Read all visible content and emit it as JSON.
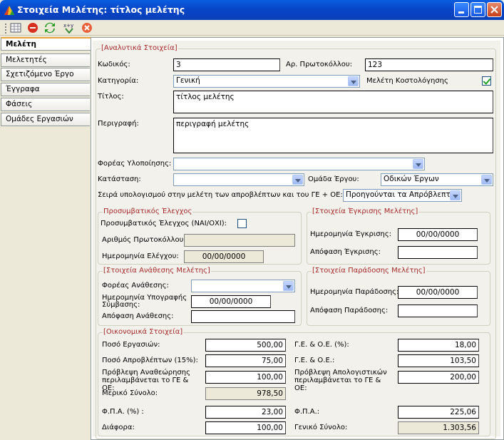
{
  "window": {
    "title": "Στοιχεία Μελέτης: τίτλος μελέτης"
  },
  "tabs": [
    "Μελέτη",
    "Μελετητές",
    "Σχετιζόμενο Έργο",
    "Έγγραφα",
    "Φάσεις",
    "Ομάδες Εργασιών"
  ],
  "analytics": {
    "legend": "[Αναλυτικά Στοιχεία]",
    "code_label": "Κωδικός:",
    "code": "3",
    "protocol_label": "Αρ. Πρωτοκόλλου:",
    "protocol": "123",
    "category_label": "Κατηγορία:",
    "category": "Γενική",
    "costing_label": "Μελέτη Κοστολόγησης",
    "costing_checked": true,
    "title_label": "Τίτλος:",
    "title": "τίτλος μελέτης",
    "desc_label": "Περιγραφή:",
    "desc": "περιγραφή μελέτης",
    "agency_label": "Φορέας Υλοποίησης:",
    "agency": "",
    "status_label": "Κατάσταση:",
    "status": "",
    "group_label": "Ομάδα Έργου:",
    "group": "Οδικών Έργων",
    "order_label": "Σειρά υπολογισμού στην μελέτη των απροβλέπτων και του ΓΕ + ΟΕ:",
    "order": "Προηγούνται τα Απρόβλεπτα"
  },
  "precontract": {
    "legend": "Προσυμβατικός Έλεγχος",
    "check_label": "Προσυμβατικός Έλεγχος (ΝΑΙ/ΟΧΙ):",
    "check_checked": false,
    "protocol_label": "Αριθμός Πρωτοκόλλου:",
    "protocol": "",
    "date_label": "Ημερομηνία Ελέγχου:",
    "date": "00/00/0000"
  },
  "approval": {
    "legend": "[Στοιχεία Έγκρισης Μελέτης]",
    "date_label": "Ημερομηνία Έγκρισης:",
    "date": "00/00/0000",
    "decision_label": "Απόφαση Έγκρισης:",
    "decision": ""
  },
  "assignment": {
    "legend": "[Στοιχεία Ανάθεσης Μελέτης]",
    "agency_label": "Φορέας Ανάθεσης:",
    "agency": "",
    "sign_label": "Ημερομηνία Υπογραφής Σύμβασης:",
    "sign_date": "00/00/0000",
    "decision_label": "Απόφαση Ανάθεσης:",
    "decision": ""
  },
  "delivery": {
    "legend": "[Στοιχεία Παράδοσης Μελέτης]",
    "date_label": "Ημερομηνία Παράδοσης:",
    "date": "00/00/0000",
    "decision_label": "Απόφαση Παράδοσης:",
    "decision": ""
  },
  "finance": {
    "legend": "[Οικονομικά Στοιχεία]",
    "works_label": "Ποσό Εργασιών:",
    "works": "500,00",
    "ge_pct_label": "Γ.Ε. & Ο.Ε. (%):",
    "ge_pct": "18,00",
    "unforeseen_label": "Ποσό Απροβλέπτων (15%):",
    "unforeseen": "75,00",
    "ge_label": "Γ.Ε. & Ο.Ε.:",
    "ge": "103,50",
    "revision_label": "Πρόβλεψη Αναθεώρησης περιλαμβάνεται το ΓΕ & ΟΕ:",
    "revision": "100,00",
    "settlement_label": "Πρόβλεψη Απολογιστικών περιλαμβάνεται το ΓΕ & ΟΕ:",
    "settlement": "200,00",
    "partial_label": "Μερικό Σύνολο:",
    "partial": "978,50",
    "vat_pct_label": "Φ.Π.Α. (%) :",
    "vat_pct": "23,00",
    "vat_label": "Φ.Π.Α.:",
    "vat": "225,06",
    "diff_label": "Διάφορα:",
    "diff": "100,00",
    "total_label": "Γενικό Σύνολο:",
    "total": "1.303,56"
  }
}
